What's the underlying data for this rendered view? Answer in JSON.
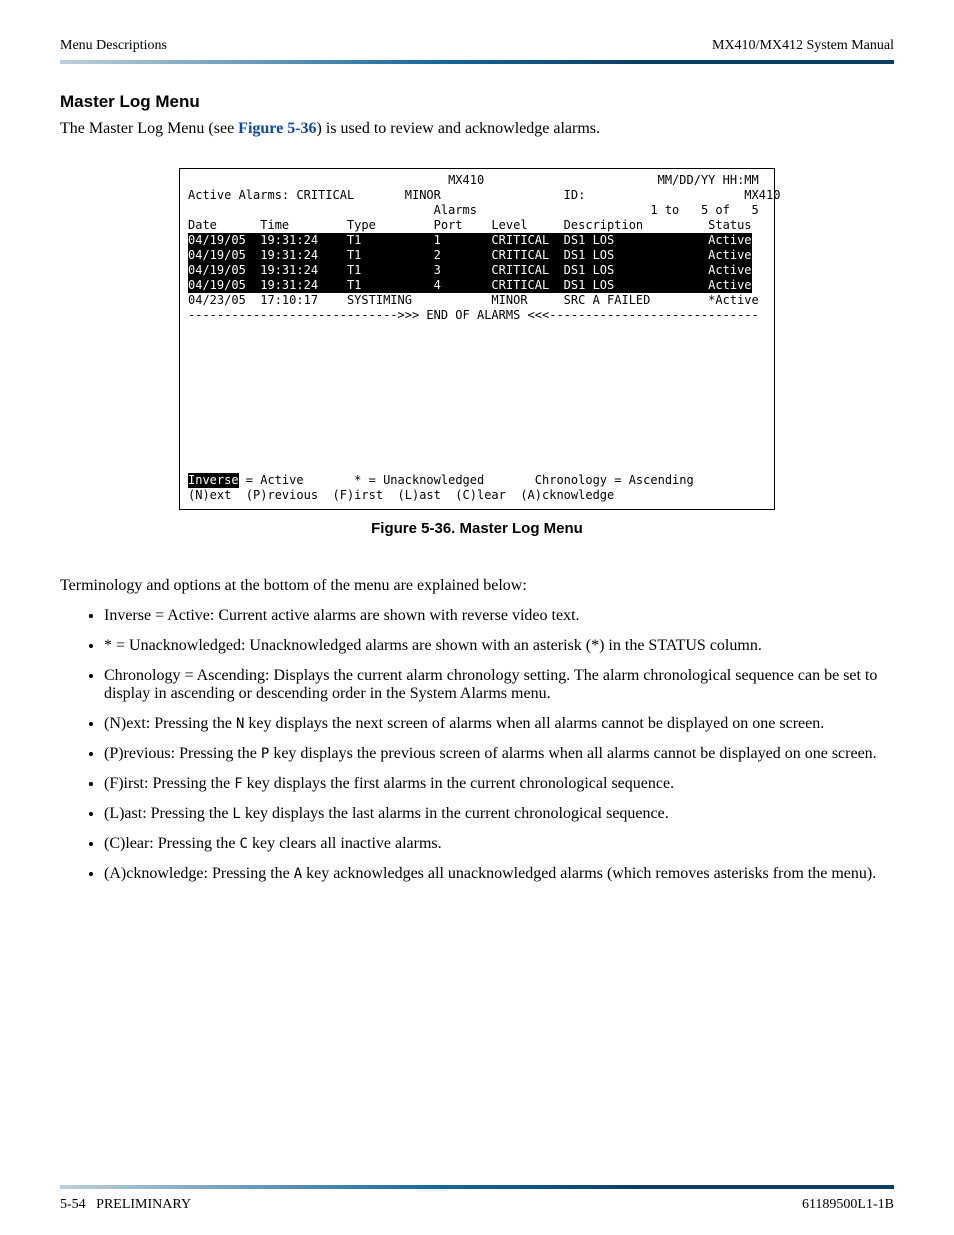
{
  "header": {
    "left": "Menu Descriptions",
    "right": "MX410/MX412 System Manual"
  },
  "section_heading": "Master Log Menu",
  "intro": {
    "pre": "The Master Log Menu (see ",
    "figref": "Figure 5-36",
    "post": ") is used to review and acknowledge alarms."
  },
  "terminal": {
    "device": "MX410",
    "timestamp": "MM/DD/YY HH:MM",
    "alarms_label": "Active Alarms:",
    "critical": "CRITICAL",
    "minor": "MINOR",
    "id_label": "ID:",
    "id_value": "MX410",
    "subtitle": "Alarms",
    "range": "1 to   5 of   5",
    "columns": {
      "date": "Date",
      "time": "Time",
      "type": "Type",
      "port": "Port",
      "level": "Level",
      "desc": "Description",
      "status": "Status"
    },
    "rows": [
      {
        "date": "04/19/05",
        "time": "19:31:24",
        "type": "T1",
        "port": "1",
        "level": "CRITICAL",
        "desc": "DS1 LOS",
        "status": "Active",
        "inverse": true
      },
      {
        "date": "04/19/05",
        "time": "19:31:24",
        "type": "T1",
        "port": "2",
        "level": "CRITICAL",
        "desc": "DS1 LOS",
        "status": "Active",
        "inverse": true
      },
      {
        "date": "04/19/05",
        "time": "19:31:24",
        "type": "T1",
        "port": "3",
        "level": "CRITICAL",
        "desc": "DS1 LOS",
        "status": "Active",
        "inverse": true
      },
      {
        "date": "04/19/05",
        "time": "19:31:24",
        "type": "T1",
        "port": "4",
        "level": "CRITICAL",
        "desc": "DS1 LOS",
        "status": "Active",
        "inverse": true
      },
      {
        "date": "04/23/05",
        "time": "17:10:17",
        "type": "SYSTIMING",
        "port": "",
        "level": "MINOR",
        "desc": "SRC A FAILED",
        "status": "*Active",
        "inverse": false
      }
    ],
    "end_line": "----------------------------->>> END OF ALARMS <<<-----------------------------",
    "legend_inverse": "Inverse",
    "legend_rest": " = Active       * = Unacknowledged       Chronology = Ascending",
    "commands": "(N)ext  (P)revious  (F)irst  (L)ast  (C)lear  (A)cknowledge"
  },
  "figure_caption": "Figure 5-36.  Master Log Menu",
  "mid_para": "Terminology and options at the bottom of the menu are explained below:",
  "bullets": [
    {
      "text": "Inverse = Active: Current active alarms are shown with reverse video text."
    },
    {
      "text": "* = Unacknowledged: Unacknowledged alarms are shown with an asterisk (*) in the STATUS column."
    },
    {
      "text": "Chronology = Ascending: Displays the current alarm chronology setting. The alarm chronological sequence can be set to display in ascending or descending order in the System Alarms menu."
    },
    {
      "pre": "(N)ext: Pressing the ",
      "key": "N",
      "post": " key displays the next screen of alarms when all alarms cannot be displayed on one screen."
    },
    {
      "pre": "(P)revious: Pressing the ",
      "key": "P",
      "post": " key displays the previous screen of alarms when all alarms cannot be displayed on one screen."
    },
    {
      "pre": "(F)irst: Pressing the ",
      "key": "F",
      "post": " key displays the first alarms in the current chronological sequence."
    },
    {
      "pre": "(L)ast: Pressing the ",
      "key": "L",
      "post": " key displays the last alarms in the current chronological sequence."
    },
    {
      "pre": "(C)lear: Pressing the ",
      "key": "C",
      "post": " key clears all inactive alarms."
    },
    {
      "pre": "(A)cknowledge: Pressing the ",
      "key": "A",
      "post": " key acknowledges all unacknowledged alarms (which removes asterisks from the menu)."
    }
  ],
  "footer": {
    "left_page": "5-54",
    "left_label": "PRELIMINARY",
    "right": "61189500L1-1B"
  }
}
